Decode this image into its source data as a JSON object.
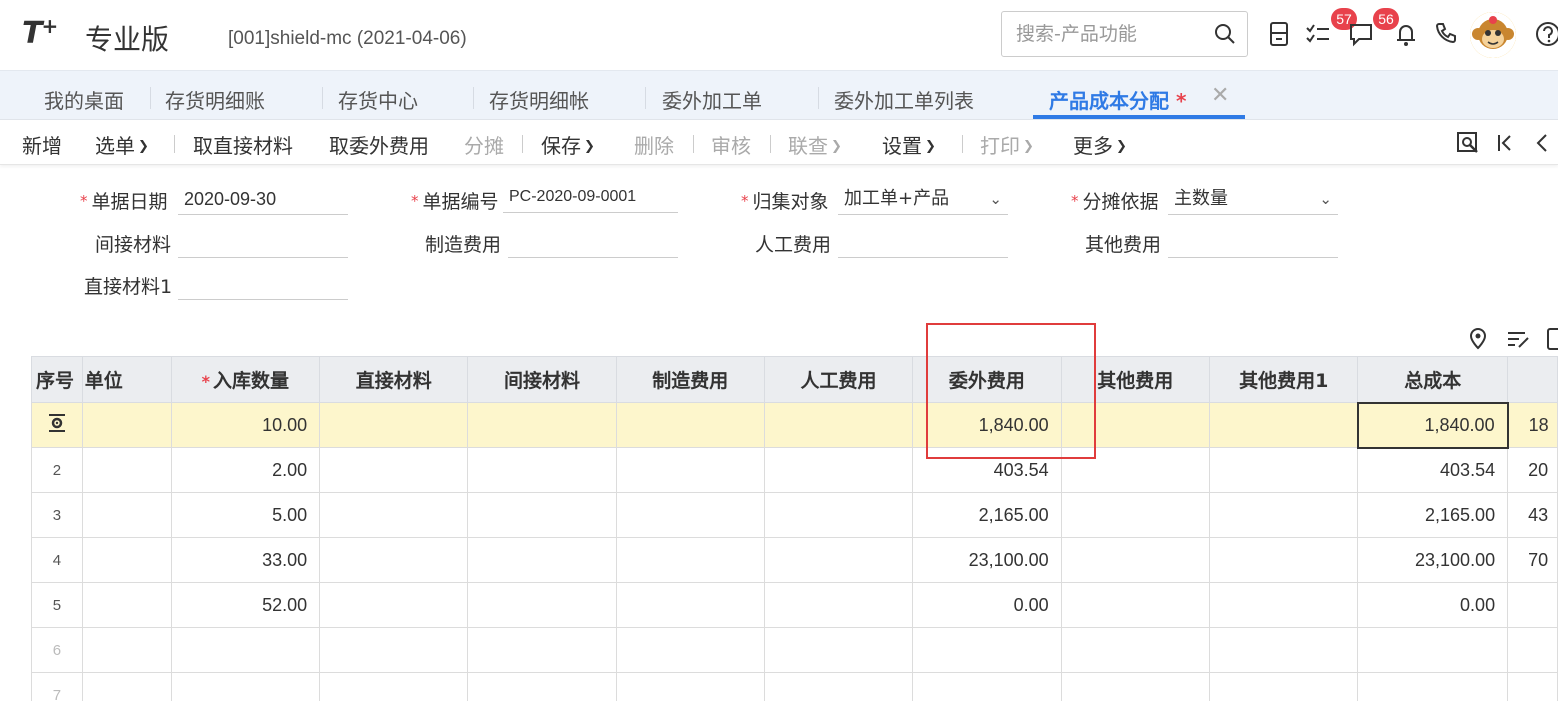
{
  "app": {
    "logo_text": "T",
    "logo_plus": "+",
    "edition": "专业版",
    "account": "[001]shield-mc   (2021-04-06)"
  },
  "search": {
    "placeholder": "搜索-产品功能"
  },
  "badges": {
    "todo": "57",
    "messages": "56"
  },
  "tabs": [
    {
      "label": "我的桌面"
    },
    {
      "label": "存货明细账"
    },
    {
      "label": "存货中心"
    },
    {
      "label": "存货明细帐"
    },
    {
      "label": "委外加工单"
    },
    {
      "label": "委外加工单列表"
    },
    {
      "label": "产品成本分配",
      "modified": "*",
      "active": true
    }
  ],
  "toolbar": {
    "new": "新增",
    "select": "选单",
    "take_direct_material": "取直接材料",
    "take_outsource_fee": "取委外费用",
    "allocate": "分摊",
    "save": "保存",
    "delete": "删除",
    "audit": "审核",
    "link_query": "联查",
    "settings": "设置",
    "print": "打印",
    "more": "更多"
  },
  "form": {
    "doc_date": {
      "label": "单据日期",
      "value": "2020-09-30"
    },
    "doc_no": {
      "label": "单据编号",
      "value": "PC-2020-09-0001"
    },
    "collect_target": {
      "label": "归集对象",
      "value": "加工单+产品"
    },
    "alloc_basis": {
      "label": "分摊依据",
      "value": "主数量"
    },
    "indirect_material": {
      "label": "间接材料",
      "value": ""
    },
    "mfg_overhead": {
      "label": "制造费用",
      "value": ""
    },
    "labor_cost": {
      "label": "人工费用",
      "value": ""
    },
    "other_cost": {
      "label": "其他费用",
      "value": ""
    },
    "direct_material1": {
      "label": "直接材料1",
      "value": ""
    }
  },
  "table": {
    "headers": {
      "seq": "序号",
      "unit": "单位",
      "qty": "入库数量",
      "direct": "直接材料",
      "indirect": "间接材料",
      "mfg": "制造费用",
      "labor": "人工费用",
      "outsource": "委外费用",
      "other": "其他费用",
      "other1": "其他费用1",
      "total": "总成本"
    },
    "rows": [
      {
        "seq": "",
        "unit": "",
        "qty": "10.00",
        "direct": "",
        "indirect": "",
        "mfg": "",
        "labor": "",
        "outsource": "1,840.00",
        "other": "",
        "other1": "",
        "total": "1,840.00",
        "extra": "18"
      },
      {
        "seq": "2",
        "unit": "",
        "qty": "2.00",
        "direct": "",
        "indirect": "",
        "mfg": "",
        "labor": "",
        "outsource": "403.54",
        "other": "",
        "other1": "",
        "total": "403.54",
        "extra": "20"
      },
      {
        "seq": "3",
        "unit": "",
        "qty": "5.00",
        "direct": "",
        "indirect": "",
        "mfg": "",
        "labor": "",
        "outsource": "2,165.00",
        "other": "",
        "other1": "",
        "total": "2,165.00",
        "extra": "43"
      },
      {
        "seq": "4",
        "unit": "",
        "qty": "33.00",
        "direct": "",
        "indirect": "",
        "mfg": "",
        "labor": "",
        "outsource": "23,100.00",
        "other": "",
        "other1": "",
        "total": "23,100.00",
        "extra": "70"
      },
      {
        "seq": "5",
        "unit": "",
        "qty": "52.00",
        "direct": "",
        "indirect": "",
        "mfg": "",
        "labor": "",
        "outsource": "0.00",
        "other": "",
        "other1": "",
        "total": "0.00",
        "extra": ""
      },
      {
        "seq": "6",
        "unit": "",
        "qty": "",
        "direct": "",
        "indirect": "",
        "mfg": "",
        "labor": "",
        "outsource": "",
        "other": "",
        "other1": "",
        "total": "",
        "extra": ""
      },
      {
        "seq": "7",
        "unit": "",
        "qty": "",
        "direct": "",
        "indirect": "",
        "mfg": "",
        "labor": "",
        "outsource": "",
        "other": "",
        "other1": "",
        "total": "",
        "extra": ""
      }
    ]
  },
  "colors": {
    "accent": "#2f7ae5",
    "badge": "#e8424c",
    "required": "#e8424c",
    "selected_row": "#fdf6cc",
    "highlight_box": "#e03c3c",
    "tabbar_bg": "#eef3fa",
    "header_bg": "#ebedf0"
  }
}
